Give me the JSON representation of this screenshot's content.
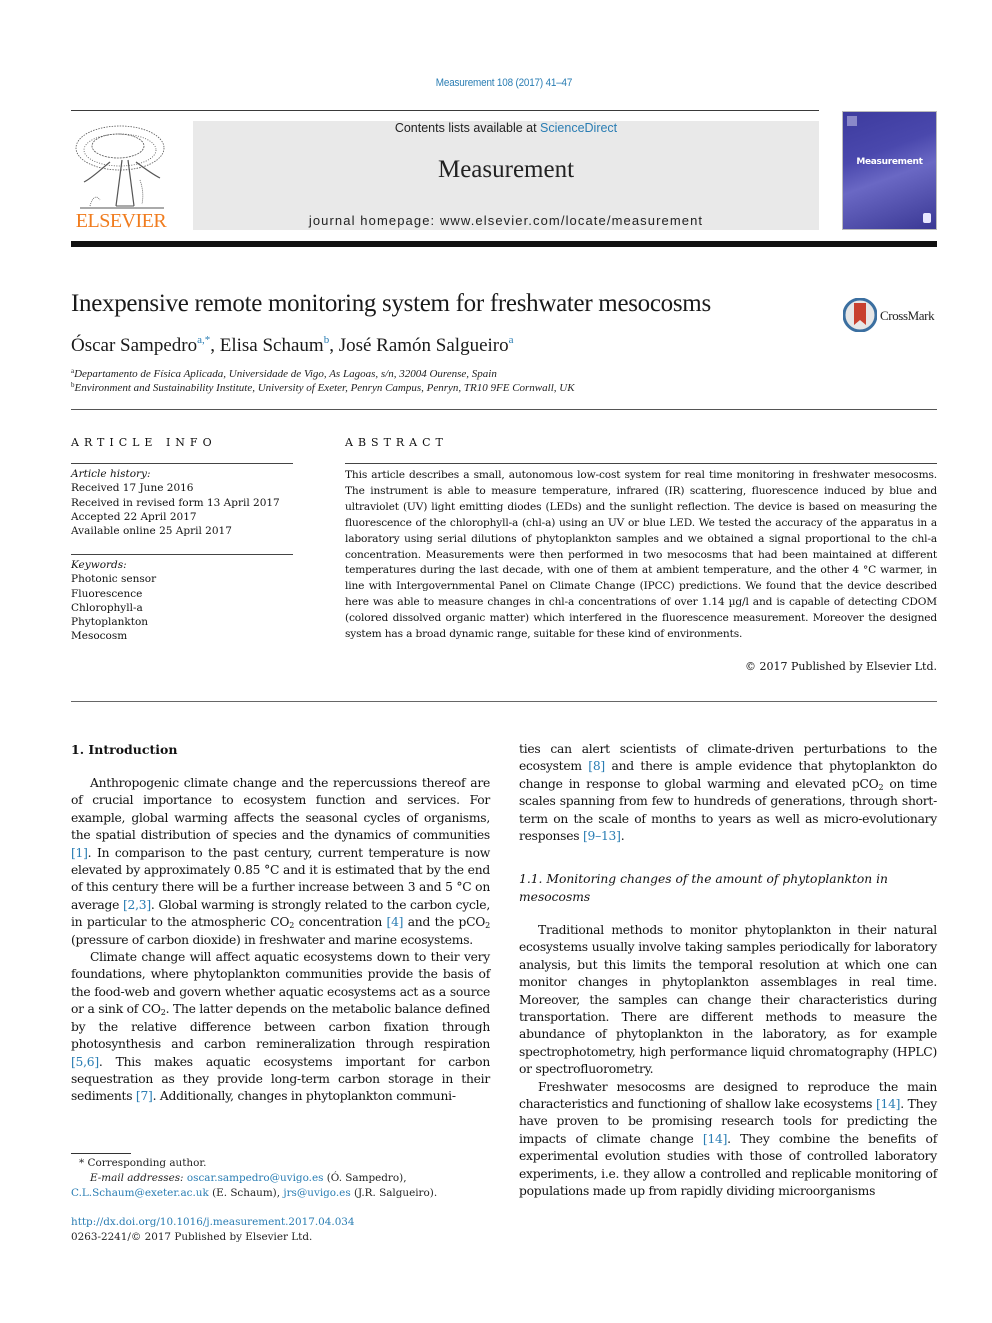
{
  "header": {
    "citation": "Measurement 108 (2017) 41–47",
    "contents_prefix": "Contents lists available at ",
    "contents_link": "ScienceDirect",
    "journal_name": "Measurement",
    "homepage": "journal homepage: www.elsevier.com/locate/measurement",
    "publisher_logo_text": "ELSEVIER",
    "cover_title": "Measurement",
    "brand_color": "#f07c1e",
    "link_color": "#2a7db3"
  },
  "article": {
    "title": "Inexpensive remote monitoring system for freshwater mesocosms",
    "crossmark_label": "CrossMark",
    "authors": [
      {
        "name": "Óscar Sampedro",
        "sup": "a,*"
      },
      {
        "name": "Elisa Schaum",
        "sup": "b"
      },
      {
        "name": "José Ramón Salgueiro",
        "sup": "a"
      }
    ],
    "affiliations": [
      {
        "key": "a",
        "text": "Departamento de Física Aplicada, Universidade de Vigo, As Lagoas, s/n, 32004 Ourense, Spain"
      },
      {
        "key": "b",
        "text": "Environment and Sustainability Institute, University of Exeter, Penryn Campus, Penryn, TR10 9FE Cornwall, UK"
      }
    ]
  },
  "article_info": {
    "heading": "ARTICLE INFO",
    "history_label": "Article history:",
    "history": [
      "Received 17 June 2016",
      "Received in revised form 13 April 2017",
      "Accepted 22 April 2017",
      "Available online 25 April 2017"
    ],
    "keywords_label": "Keywords:",
    "keywords": [
      "Photonic sensor",
      "Fluorescence",
      "Chlorophyll-a",
      "Phytoplankton",
      "Mesocosm"
    ]
  },
  "abstract": {
    "heading": "ABSTRACT",
    "text": "This article describes a small, autonomous low-cost system for real time monitoring in freshwater mesocosms. The instrument is able to measure temperature, infrared (IR) scattering, fluorescence induced by blue and ultraviolet (UV) light emitting diodes (LEDs) and the sunlight reflection. The device is based on measuring the fluorescence of the chlorophyll-a (chl-a) using an UV or blue LED. We tested the accuracy of the apparatus in a laboratory using serial dilutions of phytoplankton samples and we obtained a signal proportional to the chl-a concentration. Measurements were then performed in two mesocosms that had been maintained at different temperatures during the last decade, with one of them at ambient temperature, and the other 4 °C warmer, in line with Intergovernmental Panel on Climate Change (IPCC) predictions. We found that the device described here was able to measure changes in chl-a concentrations of over 1.14 µg/l and is capable of detecting CDOM (colored dissolved organic matter) which interfered in the fluorescence measurement. Moreover the designed system has a broad dynamic range, suitable for these kind of environments.",
    "copyright": "© 2017 Published by Elsevier Ltd."
  },
  "body": {
    "section1_heading": "1. Introduction",
    "p1": [
      "Anthropogenic climate change and the repercussions thereof are of crucial importance to ecosystem function and services. For example, global warming affects the seasonal cycles of organisms, the spatial distribution of species and the dynamics of communities ",
      "[1]",
      ". In comparison to the past century, current temperature is now elevated by approximately 0.85 °C and it is estimated that by the end of this century there will be a further increase between 3 and 5 °C on average ",
      "[2,3]",
      ". Global warming is strongly related to the carbon cycle, in particular to the atmospheric CO",
      "2",
      " concentration ",
      "[4]",
      " and the pCO",
      "2",
      " (pressure of carbon dioxide) in freshwater and marine ecosystems."
    ],
    "p2": [
      "Climate change will affect aquatic ecosystems down to their very foundations, where phytoplankton communities provide the basis of the food-web and govern whether aquatic ecosystems act as a source or a sink of CO",
      "2",
      ". The latter depends on the metabolic balance defined by the relative difference between carbon fixation through photosynthesis and carbon remineralization through respiration ",
      "[5,6]",
      ". This makes aquatic ecosystems important for carbon sequestration as they provide long-term carbon storage in their sediments ",
      "[7]",
      ". Additionally, changes in phytoplankton communi-"
    ],
    "p3": [
      "ties can alert scientists of climate-driven perturbations to the ecosystem ",
      "[8]",
      " and there is ample evidence that phytoplankton do change in response to global warming and elevated pCO",
      "2",
      " on time scales spanning from few to hundreds of generations, through short-term on the scale of months to years as well as micro-evolutionary responses ",
      "[9–13]",
      "."
    ],
    "section11_heading": "1.1. Monitoring changes of the amount of phytoplankton in mesocosms",
    "p4": "Traditional methods to monitor phytoplankton in their natural ecosystems usually involve taking samples periodically for laboratory analysis, but this limits the temporal resolution at which one can monitor changes in phytoplankton assemblages in real time. Moreover, the samples can change their characteristics during transportation. There are different methods to measure the abundance of phytoplankton in the laboratory, as for example spectrophotometry, high performance liquid chromatography (HPLC) or spectrofluorometry.",
    "p5": [
      "Freshwater mesocosms are designed to reproduce the main characteristics and functioning of shallow lake ecosystems ",
      "[14]",
      ". They have proven to be promising research tools for predicting the impacts of climate change ",
      "[14]",
      ". They combine the benefits of experimental evolution studies with those of controlled laboratory experiments, i.e. they allow a controlled and replicable monitoring of populations made up from rapidly dividing microorganisms"
    ]
  },
  "footnotes": {
    "corresponding": "* Corresponding author.",
    "email_label": "E-mail addresses: ",
    "emails": [
      {
        "addr": "oscar.sampedro@uvigo.es",
        "who": " (Ó. Sampedro), "
      },
      {
        "addr": "C.L.Schaum@exeter.ac.uk",
        "who": " (E. Schaum), "
      },
      {
        "addr": "jrs@uvigo.es",
        "who": " (J.R. Salgueiro)."
      }
    ],
    "doi": "http://dx.doi.org/10.1016/j.measurement.2017.04.034",
    "issn_line": "0263-2241/© 2017 Published by Elsevier Ltd."
  }
}
